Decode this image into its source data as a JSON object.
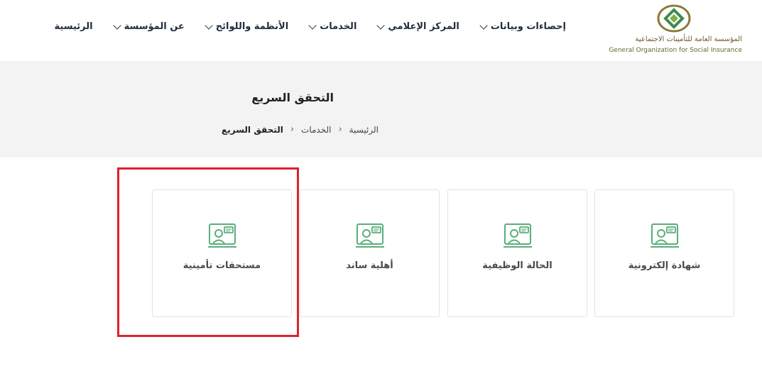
{
  "header": {
    "logo_ar": "المؤسسة العامة للتأمينات الاجتماعية",
    "logo_en": "General Organization for Social Insurance",
    "nav": [
      {
        "label": "الرئيسية",
        "dropdown": false
      },
      {
        "label": "عن المؤسسة",
        "dropdown": true
      },
      {
        "label": "الأنظمة واللوائح",
        "dropdown": true
      },
      {
        "label": "الخدمات",
        "dropdown": true
      },
      {
        "label": "المركز الإعلامي",
        "dropdown": true
      },
      {
        "label": "إحصاءات وبيانات",
        "dropdown": true
      }
    ]
  },
  "banner": {
    "title": "التحقق السريع",
    "breadcrumb": [
      "الرئيسية",
      "الخدمات",
      "التحقق السريع"
    ]
  },
  "cards": [
    {
      "label": "شهادة إلكترونية",
      "icon": "support-agent-icon"
    },
    {
      "label": "الحالة الوظيفية",
      "icon": "support-agent-icon"
    },
    {
      "label": "أهلية ساند",
      "icon": "support-agent-icon"
    },
    {
      "label": "مستحقات تأمينية",
      "icon": "support-agent-icon"
    }
  ],
  "colors": {
    "accent_green": "#5aae7a",
    "highlight_red": "#e0202c",
    "banner_bg": "#f3f3f3"
  }
}
